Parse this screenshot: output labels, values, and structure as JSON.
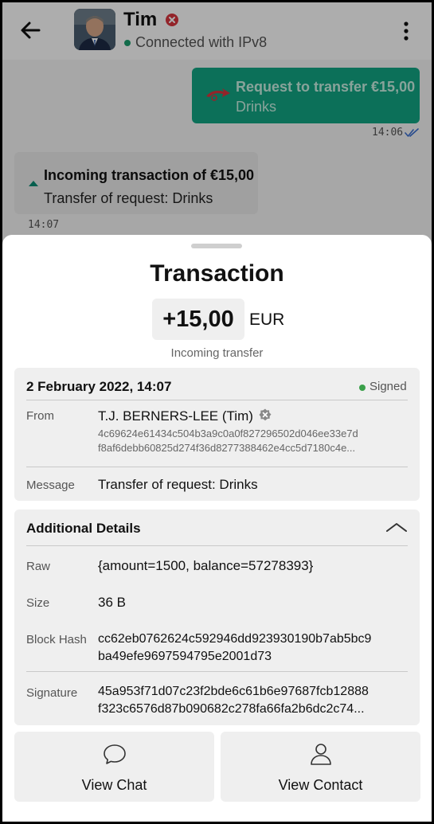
{
  "header": {
    "contact_name": "Tim",
    "status": "Connected with IPv8"
  },
  "chat": {
    "outgoing": {
      "title": "Request to transfer €15,00",
      "subtitle": "Drinks",
      "time": "14:06"
    },
    "incoming": {
      "title": "Incoming transaction of €15,00",
      "subtitle": "Transfer of request: Drinks",
      "time": "14:07"
    }
  },
  "sheet": {
    "title": "Transaction",
    "amount": "+15,00",
    "currency": "EUR",
    "type": "Incoming transfer",
    "summary": {
      "date": "2 February 2022, 14:07",
      "status": "Signed",
      "from_label": "From",
      "from_name": "T.J. BERNERS-LEE (Tim)",
      "from_key_line1": "4c69624e61434c504b3a9c0a0f827296502d046ee33e7d",
      "from_key_line2": "f8af6debb60825d274f36d8277388462e4cc5d7180c4e...",
      "message_label": "Message",
      "message": "Transfer of request: Drinks"
    },
    "details": {
      "title": "Additional Details",
      "raw_label": "Raw",
      "raw": "{amount=1500, balance=57278393}",
      "size_label": "Size",
      "size": "36 B",
      "hash_label": "Block Hash",
      "hash_line1": "cc62eb0762624c592946dd923930190b7ab5bc9",
      "hash_line2": "ba49efe9697594795e2001d73",
      "sig_label": "Signature",
      "sig_line1": "45a953f71d07c23f2bde6c61b6e97687fcb12888",
      "sig_line2": "f323c6576d87b090682c278fa66fa2b6dc2c74..."
    },
    "buttons": {
      "view_chat": "View Chat",
      "view_contact": "View Contact"
    }
  },
  "colors": {
    "accent": "#13a584",
    "signed": "#3aa04a",
    "verified_badge": "#d9363e"
  },
  "icons": [
    "back-arrow-icon",
    "verified-badge-icon",
    "more-vert-icon",
    "transfer-icon",
    "double-check-icon",
    "chevron-up-icon",
    "chat-bubble-icon",
    "person-icon"
  ]
}
